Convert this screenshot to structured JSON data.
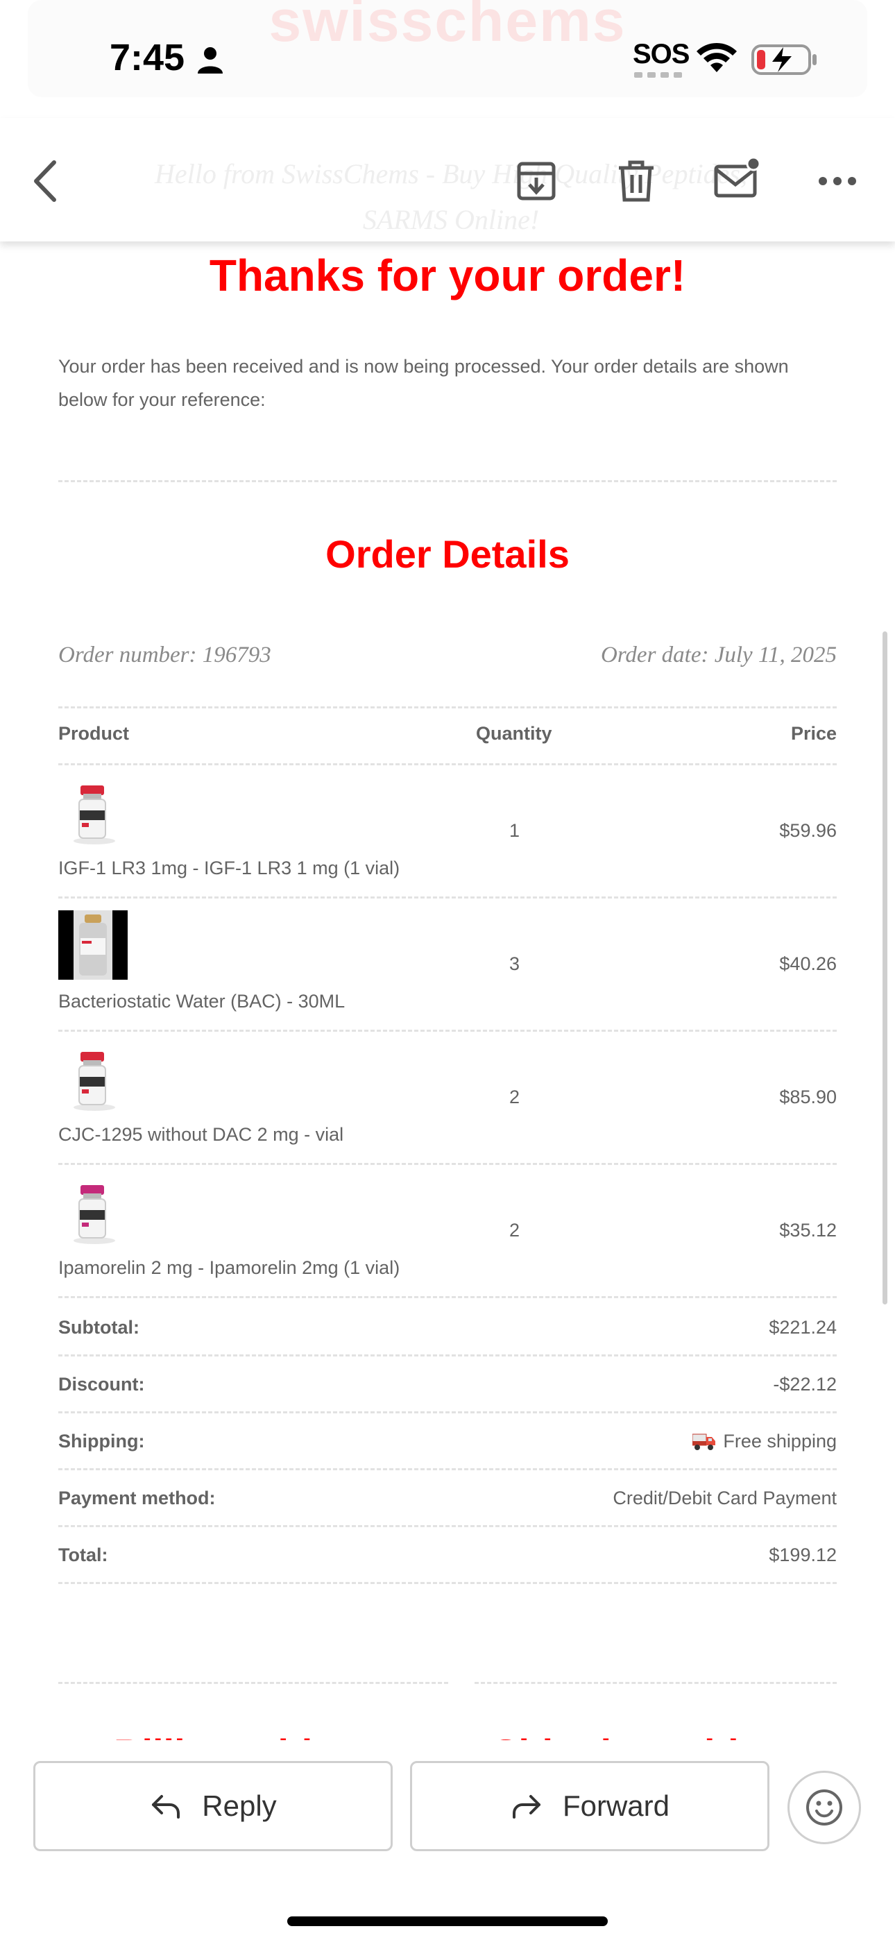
{
  "status_bar": {
    "time": "7:45",
    "sos": "SOS",
    "background_brand": "swisschems",
    "icons": [
      "person-icon",
      "wifi-icon",
      "battery-charging-icon"
    ]
  },
  "toolbar": {
    "ghost_text": "Hello from SwissChems - Buy High Quality Peptides, SARMS Online!",
    "icons": [
      "back-icon",
      "archive-icon",
      "trash-icon",
      "unread-mail-icon",
      "more-icon"
    ]
  },
  "email": {
    "thanks": "Thanks for your order!",
    "intro": "Your order has been received and is now being processed. Your order details are shown below for your reference:",
    "order_details_title": "Order Details",
    "order_number": "Order number: 196793",
    "order_date": "Order date: July 11, 2025",
    "table_headers": {
      "product": "Product",
      "quantity": "Quantity",
      "price": "Price"
    },
    "items": [
      {
        "name": "IGF-1 LR3 1mg - IGF-1 LR3 1 mg (1 vial)",
        "quantity": "1",
        "price": "$59.96",
        "cap_color": "#d8283a"
      },
      {
        "name": "Bacteriostatic Water (BAC) - 30ML",
        "quantity": "3",
        "price": "$40.26",
        "cap_color": "#c9a15a"
      },
      {
        "name": "CJC-1295 without DAC 2 mg - vial",
        "quantity": "2",
        "price": "$85.90",
        "cap_color": "#d8283a"
      },
      {
        "name": "Ipamorelin 2 mg - Ipamorelin 2mg (1 vial)",
        "quantity": "2",
        "price": "$35.12",
        "cap_color": "#c42a7a"
      }
    ],
    "totals": [
      {
        "label": "Subtotal:",
        "value": "$221.24"
      },
      {
        "label": "Discount:",
        "value": "-$22.12"
      },
      {
        "label": "Shipping:",
        "value": "Free shipping"
      },
      {
        "label": "Payment method:",
        "value": "Credit/Debit Card Payment"
      },
      {
        "label": "Total:",
        "value": "$199.12"
      }
    ],
    "cut_headings": [
      "Billing address",
      "Shipping address"
    ]
  },
  "actions": {
    "reply": "Reply",
    "forward": "Forward"
  },
  "colors": {
    "accent": "#ff0000",
    "text": "#636363",
    "meta": "#8a8a8a"
  }
}
